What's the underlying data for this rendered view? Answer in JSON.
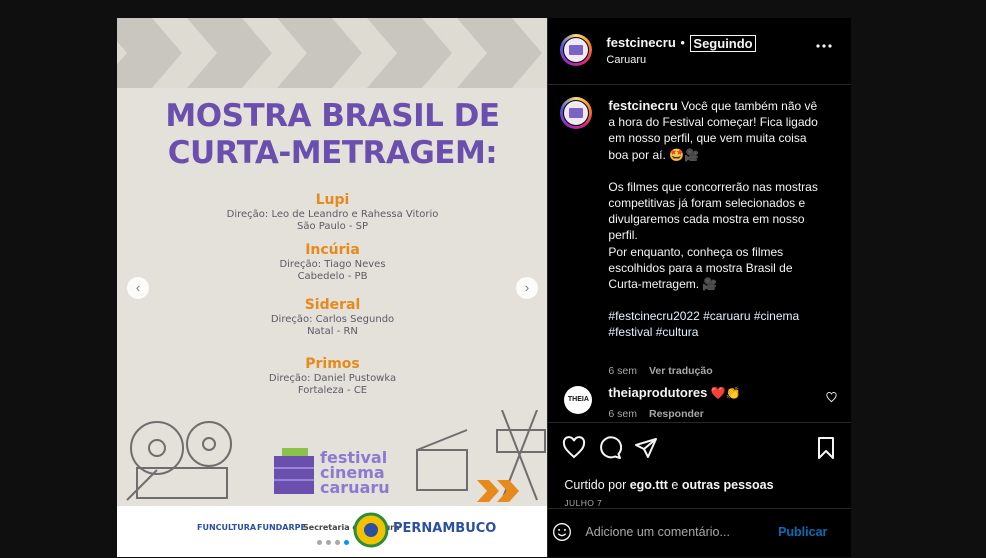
{
  "post_image": {
    "title_line1": "MOSTRA BRASIL DE",
    "title_line2": "CURTA-METRAGEM:",
    "films": [
      {
        "name": "Lupi",
        "direction": "Direção: Leo de Leandro e Rahessa Vitorio",
        "place": "São Paulo - SP"
      },
      {
        "name": "Incúria",
        "direction": "Direção: Tiago Neves",
        "place": "Cabedelo - PB"
      },
      {
        "name": "Sideral",
        "direction": "Direção: Carlos Segundo",
        "place": "Natal - RN"
      },
      {
        "name": "Primos",
        "direction": "Direção: Daniel Pustowka",
        "place": "Fortaleza - CE"
      }
    ],
    "festival_logo": [
      "festival",
      "cinema",
      "caruaru"
    ],
    "sponsors": [
      "FUNCULTURA",
      "FUNDARPE",
      "Secretaria de Cultura",
      "PERNAMBUCO"
    ],
    "carousel": {
      "count": 4,
      "active_index": 3
    },
    "prev_arrow": "‹",
    "next_arrow": "›"
  },
  "header": {
    "username": "festcinecru",
    "separator": "•",
    "follow_label": "Seguindo",
    "location": "Caruaru",
    "more_icon": "more-horizontal-icon"
  },
  "caption": {
    "username": "festcinecru",
    "paragraph1": "Você que também não vê a hora do Festival começar! Fica ligado em nosso perfil, que vem muita coisa boa por aí. 🤩🎥",
    "paragraph2": "Os filmes que concorrerão nas mostras competitivas já foram selecionados e divulgaremos cada mostra em nosso perfil.",
    "paragraph3": "Por enquanto, conheça os filmes escolhidos para a mostra Brasil de Curta-metragem. 🎥",
    "hashtags": "#festcinecru2022 #caruaru #cinema #festival #cultura",
    "time": "6 sem",
    "translate_label": "Ver tradução"
  },
  "comment": {
    "username": "theiaprodutores",
    "text": "❤️👏",
    "avatar_text": "THEIA",
    "time": "6 sem",
    "reply_label": "Responder"
  },
  "actions": {
    "likes_prefix": "Curtido por ",
    "likes_user": "ego.ttt",
    "likes_joiner": " e ",
    "likes_others": "outras pessoas",
    "date": "JULHO 7"
  },
  "add_comment": {
    "placeholder": "Adicione um comentário...",
    "publish_label": "Publicar"
  },
  "colors": {
    "accent": "#0095f6",
    "poster_purple": "#6b4fae",
    "poster_orange": "#e8891b"
  }
}
